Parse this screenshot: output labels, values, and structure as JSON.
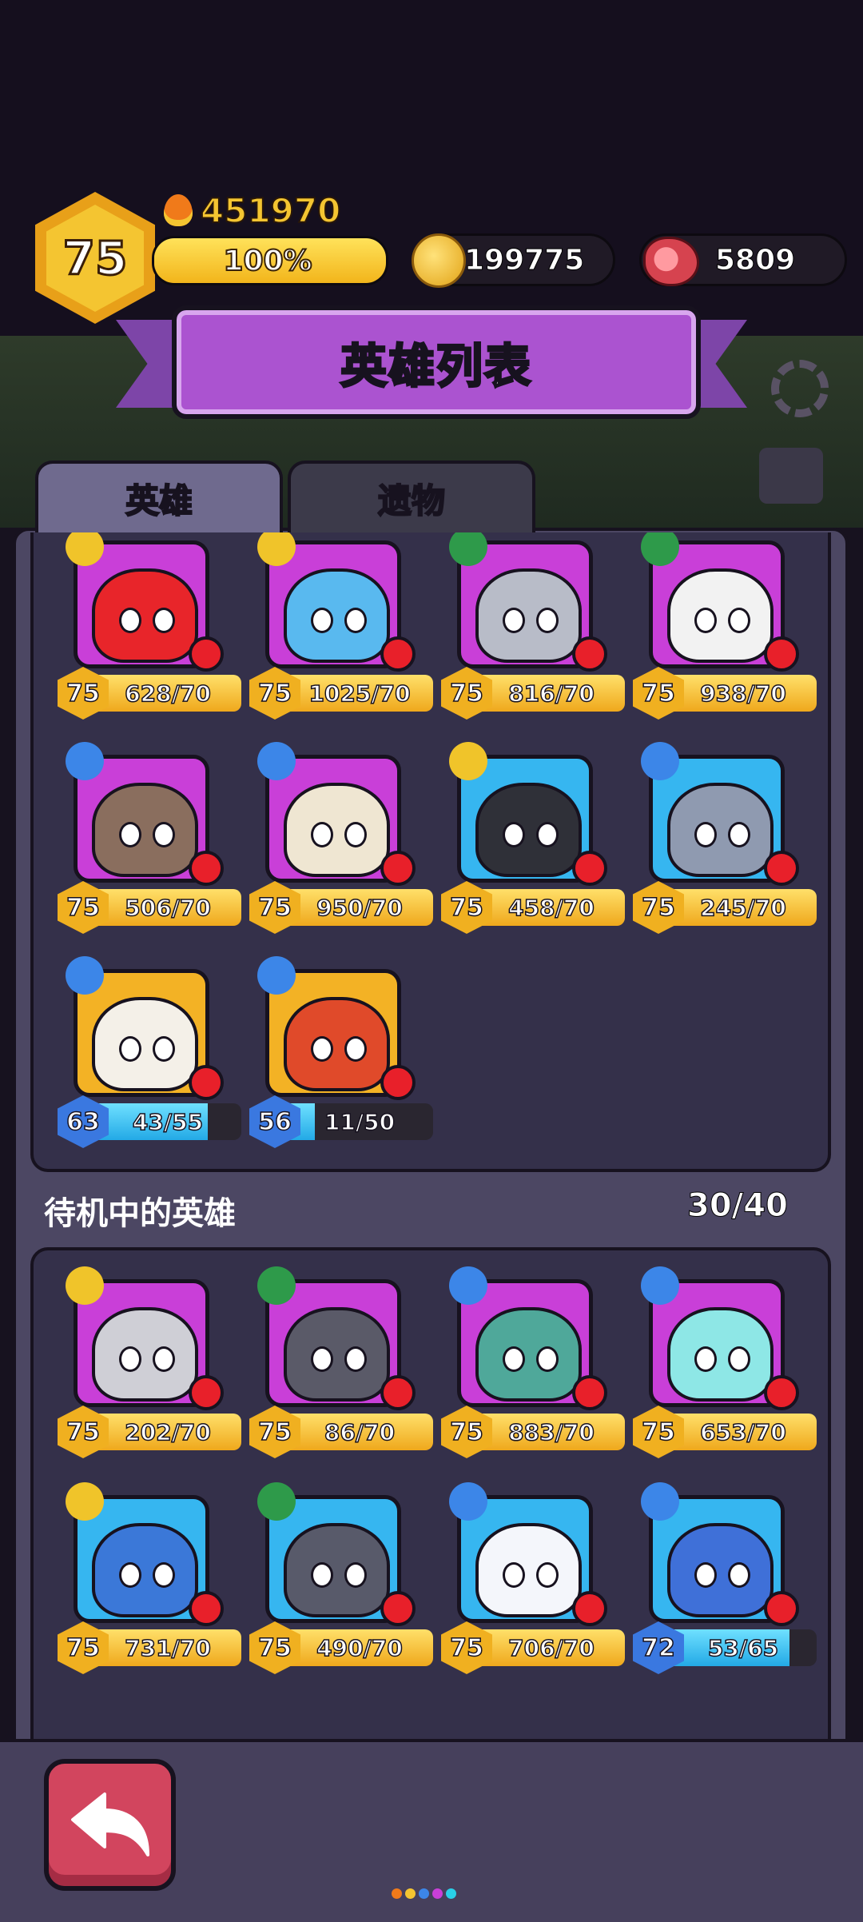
{
  "header": {
    "player_level": "75",
    "power": "451970",
    "xp_text": "100%",
    "xp_fraction": 1.0,
    "gold": "199775",
    "meat": "5809"
  },
  "banner": {
    "title": "英雄列表"
  },
  "tabs": [
    {
      "label": "英雄",
      "active": true
    },
    {
      "label": "遗物",
      "active": false
    }
  ],
  "active_heroes": [
    {
      "level": "75",
      "progress": "628/70",
      "bg": "purple",
      "rank": "gold",
      "body": "#e8252a",
      "bar": "gold",
      "fill": 1.0
    },
    {
      "level": "75",
      "progress": "1025/70",
      "bg": "purple",
      "rank": "gold",
      "body": "#59b9ef",
      "bar": "gold",
      "fill": 1.0
    },
    {
      "level": "75",
      "progress": "816/70",
      "bg": "purple",
      "rank": "green",
      "body": "#b8bcc8",
      "bar": "gold",
      "fill": 1.0
    },
    {
      "level": "75",
      "progress": "938/70",
      "bg": "purple",
      "rank": "green",
      "body": "#f2f2f2",
      "bar": "gold",
      "fill": 1.0
    },
    {
      "level": "75",
      "progress": "506/70",
      "bg": "purple",
      "rank": "blue",
      "body": "#8a6e5e",
      "bar": "gold",
      "fill": 1.0
    },
    {
      "level": "75",
      "progress": "950/70",
      "bg": "purple",
      "rank": "blue",
      "body": "#efe6d2",
      "bar": "gold",
      "fill": 1.0
    },
    {
      "level": "75",
      "progress": "458/70",
      "bg": "blue",
      "rank": "gold",
      "body": "#2f3038",
      "bar": "gold",
      "fill": 1.0
    },
    {
      "level": "75",
      "progress": "245/70",
      "bg": "blue",
      "rank": "blue",
      "body": "#8f9ab0",
      "bar": "gold",
      "fill": 1.0
    },
    {
      "level": "63",
      "progress": "43/55",
      "bg": "gold",
      "rank": "blue",
      "body": "#f4f0e8",
      "bar": "blue",
      "fill": 0.78
    },
    {
      "level": "56",
      "progress": "11/50",
      "bg": "gold",
      "rank": "blue",
      "body": "#e04a2a",
      "bar": "blue",
      "fill": 0.22
    }
  ],
  "idle_section": {
    "label": "待机中的英雄",
    "count": "30/40"
  },
  "idle_heroes": [
    {
      "level": "75",
      "progress": "202/70",
      "bg": "purple",
      "rank": "gold",
      "body": "#cfcfd6",
      "bar": "gold",
      "fill": 1.0
    },
    {
      "level": "75",
      "progress": "86/70",
      "bg": "purple",
      "rank": "green",
      "body": "#5a5a68",
      "bar": "gold",
      "fill": 1.0
    },
    {
      "level": "75",
      "progress": "883/70",
      "bg": "purple",
      "rank": "blue",
      "body": "#4fa89a",
      "bar": "gold",
      "fill": 1.0
    },
    {
      "level": "75",
      "progress": "653/70",
      "bg": "purple",
      "rank": "blue",
      "body": "#8ee7e6",
      "bar": "gold",
      "fill": 1.0
    },
    {
      "level": "75",
      "progress": "731/70",
      "bg": "blue",
      "rank": "gold",
      "body": "#3b78d8",
      "bar": "gold",
      "fill": 1.0
    },
    {
      "level": "75",
      "progress": "490/70",
      "bg": "blue",
      "rank": "green",
      "body": "#585a6a",
      "bar": "gold",
      "fill": 1.0
    },
    {
      "level": "75",
      "progress": "706/70",
      "bg": "blue",
      "rank": "blue",
      "body": "#f4f6fb",
      "bar": "gold",
      "fill": 1.0
    },
    {
      "level": "72",
      "progress": "53/65",
      "bg": "blue",
      "rank": "blue",
      "body": "#3f70d8",
      "bar": "blue",
      "fill": 0.82
    }
  ],
  "colors": {
    "accent_purple": "#ab53d0",
    "gold": "#f4c531",
    "back_button": "#d2455e",
    "page_dots": [
      "#f07a1a",
      "#f4c531",
      "#3c86e8",
      "#c93fd8",
      "#29d0e8"
    ]
  }
}
